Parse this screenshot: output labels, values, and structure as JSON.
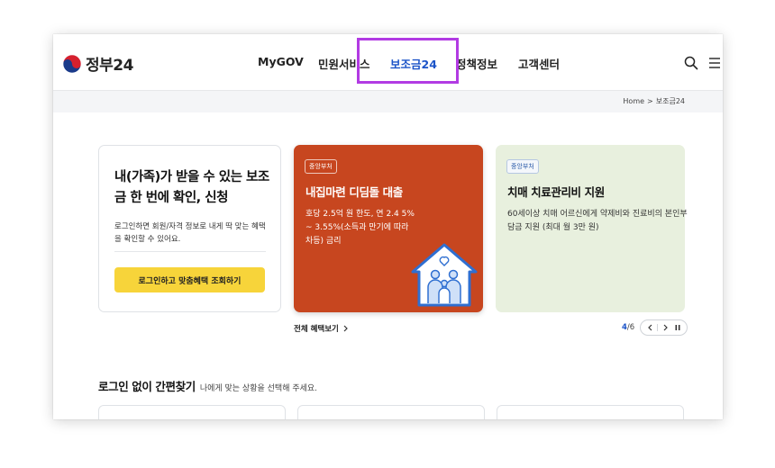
{
  "header": {
    "logo_text": "정부24",
    "nav": [
      {
        "label": "MyGOV"
      },
      {
        "label": "민원서비스"
      },
      {
        "label": "보조금24",
        "active": true
      },
      {
        "label": "정책정보"
      },
      {
        "label": "고객센터"
      }
    ],
    "icons": {
      "search": "search-icon",
      "menu": "menu-icon"
    }
  },
  "breadcrumb": {
    "home": "Home",
    "separator": ">",
    "current": "보조금24"
  },
  "login_card": {
    "title": "내(가족)가 받을 수 있는 보조금 한 번에 확인, 신청",
    "description": "로그인하면 회원/자격 정보로 내게 딱 맞는 혜택을 확인할 수 있어요.",
    "button": "로그인하고 맞춤혜택 조회하기"
  },
  "slides": [
    {
      "badge": "중앙부처",
      "title": "내집마련 디딤돌 대출",
      "description": "호당 2.5억 원 한도, 연 2.4 5% ~ 3.55%(소득과 만기에 따라 차등) 금리",
      "icon": "family-house-icon"
    },
    {
      "badge": "중앙부처",
      "title": "치매 치료관리비 지원",
      "description": "60세이상 치매 어르신에게 약제비와 진료비의 본인부담금 지원 (최대 월 3만 원)"
    }
  ],
  "all_benefits": "전체 혜택보기",
  "pager": {
    "current": "4",
    "separator": "/",
    "total": "6"
  },
  "quick_search": {
    "title": "로그인 없이 간편찾기",
    "subtitle": "나에게 맞는 상황을 선택해 주세요."
  },
  "colors": {
    "brand_blue": "#1c54c8",
    "orange_card": "#c7461f",
    "green_card": "#e8f0de",
    "login_button": "#f7d43a",
    "highlight": "#b23be3"
  }
}
